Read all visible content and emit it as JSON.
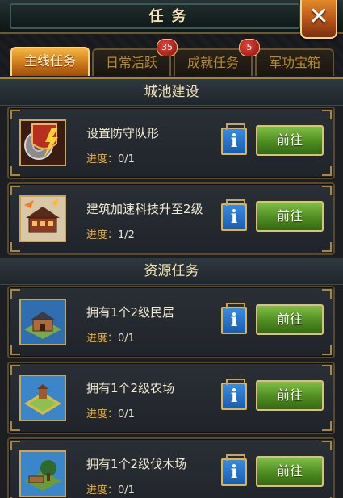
{
  "header": {
    "title": "任务",
    "close_icon": "close-icon"
  },
  "tabs": [
    {
      "label": "主线任务",
      "active": true,
      "badge": ""
    },
    {
      "label": "日常活跃",
      "active": false,
      "badge": "35"
    },
    {
      "label": "成就任务",
      "active": false,
      "badge": "5"
    },
    {
      "label": "军功宝箱",
      "active": false,
      "badge": ""
    }
  ],
  "sections": [
    {
      "title": "城池建设",
      "tasks": [
        {
          "name": "设置防守队形",
          "progress_label": "进度：",
          "progress_value": "0/1",
          "icon": "defense-formation-icon",
          "go_label": "前往"
        },
        {
          "name": "建筑加速科技升至2级",
          "progress_label": "进度：",
          "progress_value": "1/2",
          "icon": "build-speed-tech-icon",
          "go_label": "前往"
        }
      ]
    },
    {
      "title": "资源任务",
      "tasks": [
        {
          "name": "拥有1个2级民居",
          "progress_label": "进度：",
          "progress_value": "0/1",
          "icon": "residence-icon",
          "go_label": "前往"
        },
        {
          "name": "拥有1个2级农场",
          "progress_label": "进度：",
          "progress_value": "0/1",
          "icon": "farm-icon",
          "go_label": "前往"
        },
        {
          "name": "拥有1个2级伐木场",
          "progress_label": "进度：",
          "progress_value": "0/1",
          "icon": "lumber-mill-icon",
          "go_label": "前往"
        }
      ]
    }
  ],
  "colors": {
    "accent_gold": "#c9a55a",
    "go_green": "#4f8c21",
    "info_blue": "#1b5dae",
    "tab_orange": "#c97318",
    "badge_red": "#c0231c"
  }
}
